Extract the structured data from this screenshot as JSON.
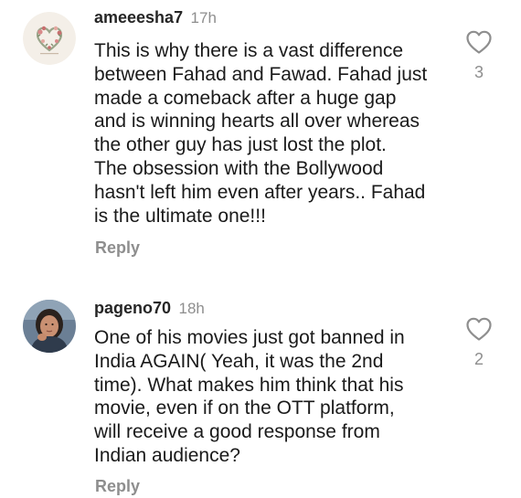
{
  "comments": [
    {
      "username": "ameeesha7",
      "time": "17h",
      "text": "This is why there is a vast difference\nbetween Fahad and Fawad. Fahad just\nmade a comeback after a huge gap\nand is winning hearts all over whereas\nthe other guy has just lost the plot.\nThe obsession with the Bollywood\nhasn't left him even after years.. Fahad\nis the ultimate one!!!",
      "reply_label": "Reply",
      "likes": "3",
      "avatar_icon": "floral-heart-avatar"
    },
    {
      "username": "pageno70",
      "time": "18h",
      "text": "One of his movies just got banned in\nIndia AGAIN( Yeah, it was the 2nd\ntime). What makes him think that his\nmovie, even if on the OTT platform,\nwill receive a good response from\nIndian audience?",
      "reply_label": "Reply",
      "likes": "2",
      "avatar_icon": "person-photo-avatar"
    }
  ],
  "colors": {
    "username": "#262626",
    "muted": "#8e8e8e",
    "text": "#1a1a1a",
    "heart_outline": "#8e8e8e"
  },
  "icons": {
    "like": "heart-outline-icon"
  }
}
